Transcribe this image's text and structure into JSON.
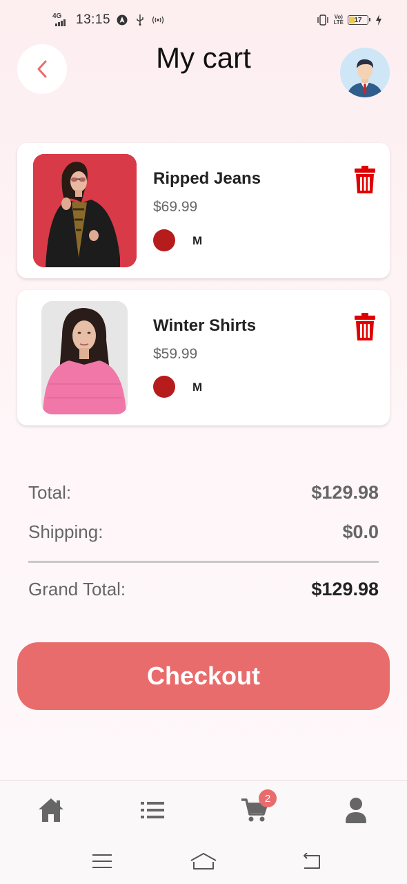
{
  "status_bar": {
    "network": "4G",
    "time": "13:15",
    "battery": "17",
    "volte_line1": "Vo)",
    "volte_line2": "LTE"
  },
  "header": {
    "title": "My cart"
  },
  "cart": {
    "items": [
      {
        "name": "Ripped Jeans",
        "price": "$69.99",
        "size": "M",
        "color": "#b71c1c"
      },
      {
        "name": "Winter Shirts",
        "price": "$59.99",
        "size": "M",
        "color": "#b71c1c"
      }
    ]
  },
  "summary": {
    "total_label": "Total:",
    "total_value": "$129.98",
    "shipping_label": "Shipping:",
    "shipping_value": "$0.0",
    "grand_label": "Grand Total:",
    "grand_value": "$129.98"
  },
  "checkout_label": "Checkout",
  "bottom_nav": {
    "cart_badge": "2",
    "items": [
      "home-icon",
      "list-icon",
      "cart-icon",
      "profile-icon"
    ]
  },
  "colors": {
    "accent": "#e96c6d",
    "delete": "#e00000",
    "swatch": "#b71c1c"
  }
}
